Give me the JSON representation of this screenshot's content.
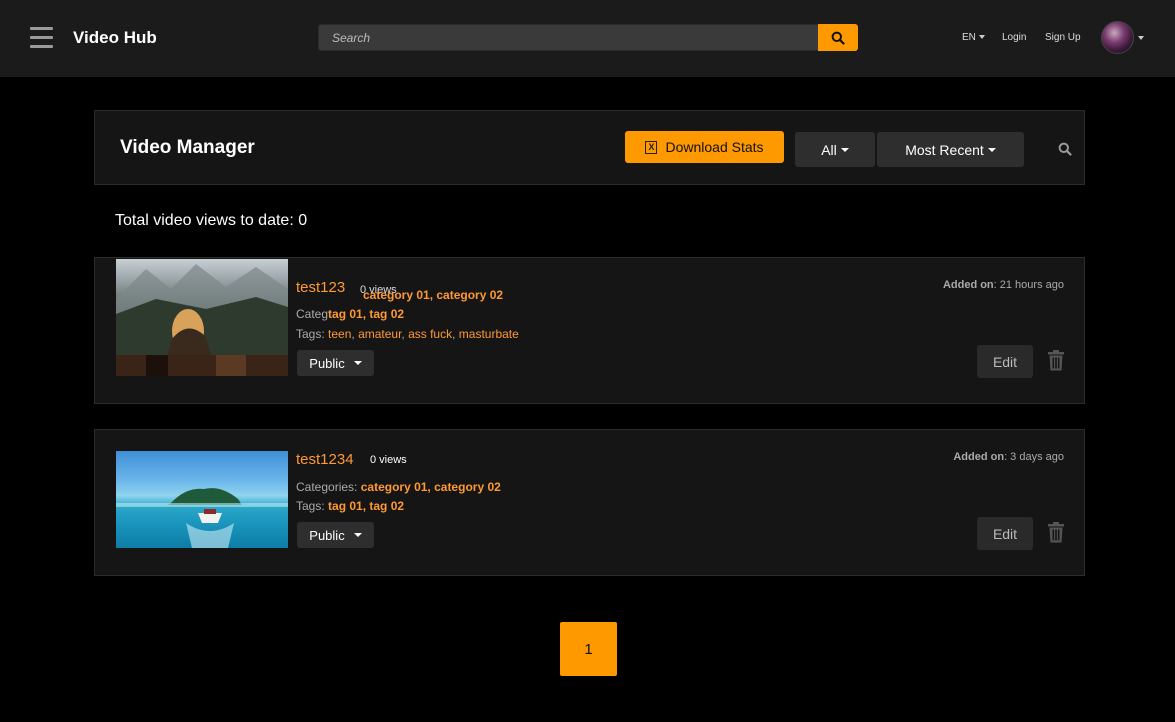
{
  "header": {
    "brand": "Video Hub",
    "search_placeholder": "Search",
    "lang": "EN",
    "login": "Login",
    "signup": "Sign Up"
  },
  "manager": {
    "title": "Video Manager",
    "download_label": "Download Stats",
    "filter_label": "All",
    "sort_label": "Most Recent",
    "total_text": "Total video views to date: 0"
  },
  "videos": [
    {
      "title": "test123",
      "views": "0 views",
      "categories_label": "Categ",
      "categories": "category 01, category 02",
      "tags_label": "tag 01, tag 02",
      "tags_prefix": "Tags:",
      "extra_tags": [
        "teen",
        "amateur",
        "ass fuck",
        "masturbate"
      ],
      "visibility": "Public",
      "added_label": "Added on",
      "added_value": ": 21 hours ago",
      "edit_label": "Edit"
    },
    {
      "title": "test1234",
      "views": "0 views",
      "categories_label": "Categories:",
      "categories": "category 01, category 02",
      "tags_prefix": "Tags:",
      "tags": "tag 01, tag 02",
      "visibility": "Public",
      "added_label": "Added on",
      "added_value": ": 3 days ago",
      "edit_label": "Edit"
    }
  ],
  "pagination": {
    "current": "1"
  },
  "colors": {
    "accent": "#ff9900",
    "link": "#ff9933",
    "header_bg": "#1b1b1b",
    "panel_bg": "#151515"
  },
  "icons": [
    "menu-icon",
    "search-icon",
    "excel-icon",
    "trash-icon"
  ]
}
